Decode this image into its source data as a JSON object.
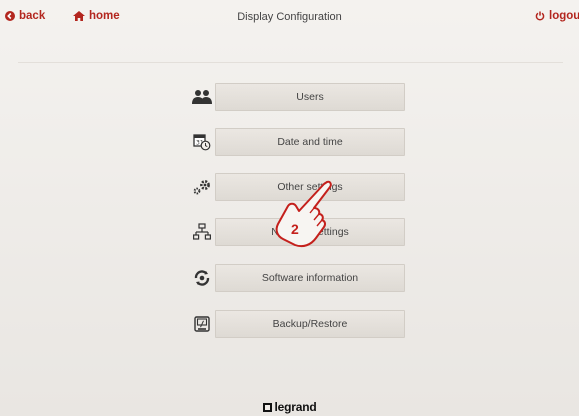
{
  "header": {
    "back_label": "back",
    "home_label": "home",
    "title": "Display Configuration",
    "logout_label": "logout"
  },
  "menu": {
    "items": [
      {
        "label": "Users",
        "icon": "users-icon"
      },
      {
        "label": "Date and time",
        "icon": "calendar-clock-icon"
      },
      {
        "label": "Other settings",
        "icon": "gears-icon"
      },
      {
        "label": "Network settings",
        "icon": "network-icon"
      },
      {
        "label": "Software information",
        "icon": "software-disc-icon"
      },
      {
        "label": "Backup/Restore",
        "icon": "backup-icon"
      }
    ]
  },
  "annotation": {
    "step_number": "2"
  },
  "footer": {
    "brand": "legrand"
  },
  "colors": {
    "accent": "#b3261e",
    "button_bg": "#e3dfd9",
    "page_bg": "#eeebe7"
  }
}
